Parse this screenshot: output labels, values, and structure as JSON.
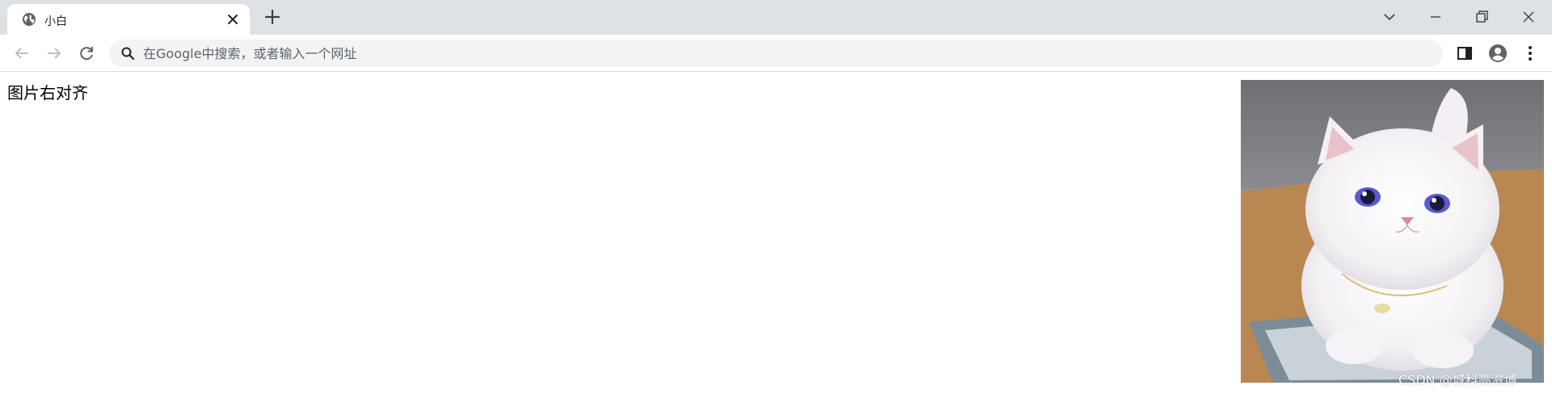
{
  "browser": {
    "tab": {
      "title": "小白",
      "favicon": "globe-icon"
    },
    "window_controls": [
      "chevron-down-icon",
      "minimize-icon",
      "restore-icon",
      "close-icon"
    ]
  },
  "toolbar": {
    "omnibox": {
      "placeholder": "在Google中搜索，或者输入一个网址",
      "value": ""
    },
    "icons": [
      "back-arrow-icon",
      "forward-arrow-icon",
      "reload-icon",
      "search-icon",
      "side-panel-icon",
      "profile-avatar-icon",
      "kebab-menu-icon"
    ]
  },
  "page": {
    "text": "图片右对齐",
    "image": {
      "alt": "white kitten photo"
    },
    "watermark": "CSDN @城科高滋博"
  },
  "colors": {
    "tab_strip_bg": "#dee1e6",
    "omnibox_bg": "#f1f3f4",
    "icon_color": "#5f6368",
    "disabled_icon": "#bdc1c6"
  }
}
